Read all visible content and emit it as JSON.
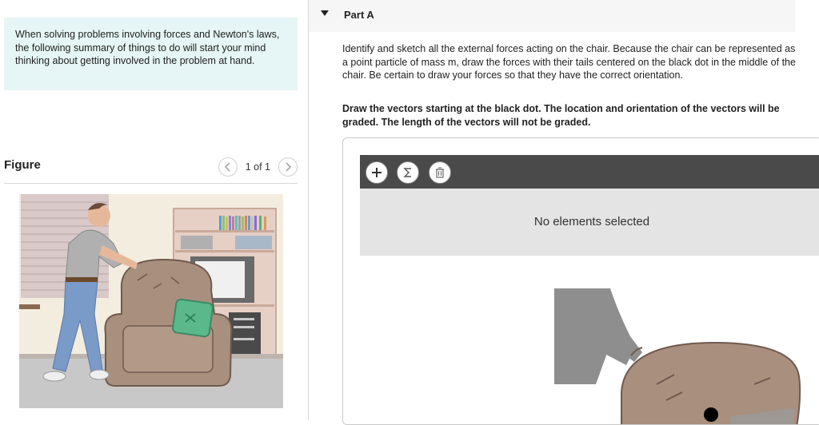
{
  "hint": {
    "text": "When solving problems involving forces and Newton's laws, the following summary of things to do will start your mind thinking about getting involved in the problem at hand."
  },
  "figure": {
    "title": "Figure",
    "pager_text": "1 of 1",
    "prev_icon": "chevron-left-icon",
    "next_icon": "chevron-right-icon"
  },
  "part": {
    "title": "Part A",
    "caret_icon": "caret-down-icon"
  },
  "instructions": {
    "text": "Identify and sketch all the external forces acting on the chair. Because the chair can be represented as a point particle of mass m, draw the forces with their tails centered on the black dot in the middle of the chair. Be certain to draw your forces so that they have the correct orientation.",
    "bold_text": "Draw the vectors starting at the black dot. The location and orientation of the vectors will be graded. The length of the vectors will not be graded."
  },
  "widget": {
    "tools": [
      "plus-icon",
      "sigma-icon",
      "trash-icon"
    ],
    "status_text": "No elements selected"
  },
  "colors": {
    "hint_bg": "#e6f5f5",
    "toolbar_bg": "#4a4a4a",
    "status_bg": "#e4e4e4"
  }
}
